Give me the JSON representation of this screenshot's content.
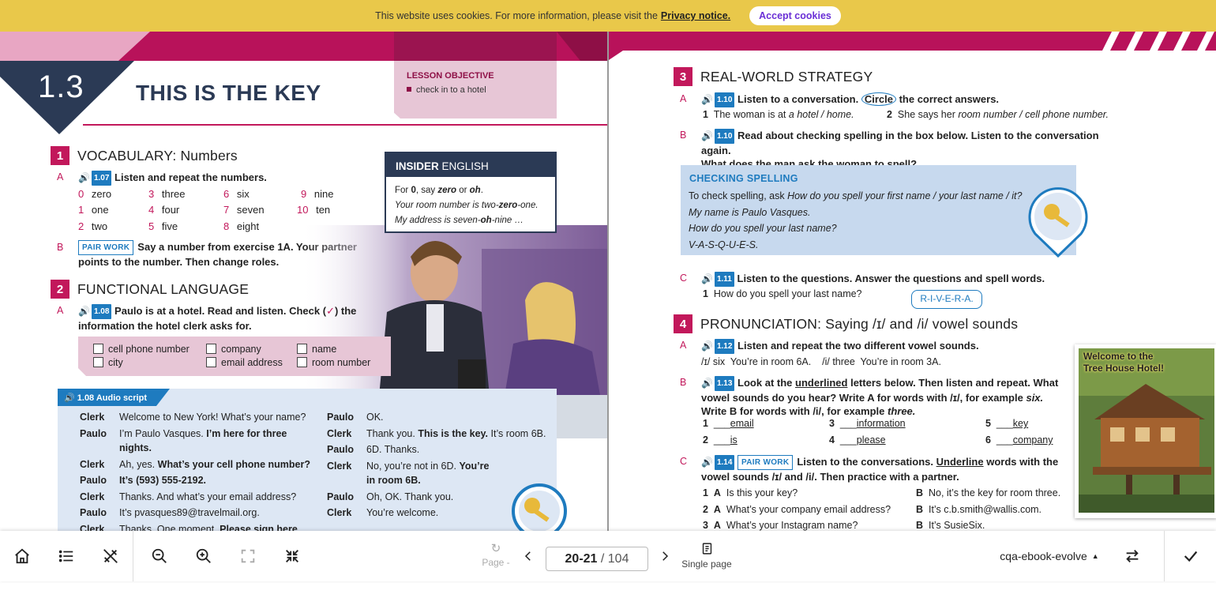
{
  "cookie_bar": {
    "text": "This website uses cookies. For more information, please visit the",
    "link": "Privacy notice.",
    "button": "Accept cookies"
  },
  "left_page": {
    "lesson_number": "1.3",
    "lesson_title": "THIS IS THE KEY",
    "objective_heading": "LESSON OBJECTIVE",
    "objective_item": "check in to a hotel",
    "section1": {
      "number": "1",
      "title": "VOCABULARY: Numbers",
      "a_letter": "A",
      "a_track": "1.07",
      "a_instruction": "Listen and repeat the numbers.",
      "numbers": [
        {
          "n": "0",
          "w": "zero"
        },
        {
          "n": "3",
          "w": "three"
        },
        {
          "n": "6",
          "w": "six"
        },
        {
          "n": "9",
          "w": "nine"
        },
        {
          "n": "1",
          "w": "one"
        },
        {
          "n": "4",
          "w": "four"
        },
        {
          "n": "7",
          "w": "seven"
        },
        {
          "n": "10",
          "w": "ten"
        },
        {
          "n": "2",
          "w": "two"
        },
        {
          "n": "5",
          "w": "five"
        },
        {
          "n": "8",
          "w": "eight"
        }
      ],
      "b_letter": "B",
      "b_tag": "PAIR WORK",
      "b_instruction_1": "Say a number from exercise 1A. Your partner",
      "b_instruction_2": "points to the number. Then change roles."
    },
    "insider": {
      "heading_bold": "INSIDER",
      "heading_rest": "ENGLISH",
      "line1_a": "For",
      "line1_b": "0",
      "line1_c": ", say",
      "line1_d": "zero",
      "line1_e": "or",
      "line1_f": "oh",
      "line2_a": "Your room number is two-",
      "line2_b": "zero",
      "line2_c": "-one.",
      "line3_a": "My address is seven-",
      "line3_b": "oh",
      "line3_c": "-nine …"
    },
    "section2": {
      "number": "2",
      "title": "FUNCTIONAL LANGUAGE",
      "a_letter": "A",
      "a_track": "1.08",
      "a_instruction_1": "Paulo is at a hotel. Read and listen. Check (",
      "a_check": "✓",
      "a_instruction_1b": ") the",
      "a_instruction_2": "information the hotel clerk asks for.",
      "checkboxes": [
        "cell phone number",
        "company",
        "name",
        "city",
        "email address",
        "room number"
      ]
    },
    "script": {
      "title": "1.08 Audio script",
      "left": [
        {
          "speaker": "Clerk",
          "text": "Welcome to New York! What’s your name?",
          "bold": ""
        },
        {
          "speaker": "Paulo",
          "text": "I’m Paulo Vasques.",
          "bold": "I’m here for three"
        },
        {
          "speaker": "",
          "text": "",
          "bold": "nights."
        },
        {
          "speaker": "Clerk",
          "text": "Ah, yes.",
          "bold": "What’s your cell phone number?"
        },
        {
          "speaker": "Paulo",
          "text": "",
          "bold": "It’s (593) 555-2192."
        },
        {
          "speaker": "Clerk",
          "text": "Thanks. And what’s your email address?",
          "bold": ""
        },
        {
          "speaker": "Paulo",
          "text": "It’s pvasques89@travelmail.org.",
          "bold": ""
        },
        {
          "speaker": "Clerk",
          "text": "Thanks. One moment.",
          "bold": "Please sign here."
        }
      ],
      "right": [
        {
          "speaker": "Paulo",
          "text": "OK.",
          "bold": "",
          "after": ""
        },
        {
          "speaker": "Clerk",
          "text": "Thank you.",
          "bold": "This is the key.",
          "after": "It’s room 6B."
        },
        {
          "speaker": "Paulo",
          "text": "6D. Thanks.",
          "bold": "",
          "after": ""
        },
        {
          "speaker": "Clerk",
          "text": "No, you’re not in 6D.",
          "bold": "You’re",
          "after": ""
        },
        {
          "speaker": "",
          "text": "",
          "bold": "in room 6B.",
          "after": ""
        },
        {
          "speaker": "Paulo",
          "text": "Oh, OK. Thank you.",
          "bold": "",
          "after": ""
        },
        {
          "speaker": "Clerk",
          "text": "You’re welcome.",
          "bold": "",
          "after": ""
        }
      ]
    }
  },
  "right_page": {
    "section3": {
      "number": "3",
      "title": "REAL-WORLD STRATEGY",
      "a_letter": "A",
      "a_track": "1.10",
      "a_instruction_1": "Listen to a conversation.",
      "a_circle": "Circle",
      "a_instruction_2": "the correct answers.",
      "a_q1_n": "1",
      "a_q1": "The woman is at",
      "a_q1_i": "a hotel / home.",
      "a_q2_n": "2",
      "a_q2": "She says her",
      "a_q2_i": "room number / cell phone number.",
      "b_letter": "B",
      "b_track": "1.10",
      "b_instruction_1": "Read about checking spelling in the box below. Listen to the conversation again.",
      "b_instruction_2": "What does the man ask the woman to spell?",
      "box_title": "CHECKING SPELLING",
      "box_line1_a": "To check spelling, ask",
      "box_line1_b": "How do you spell your first name / your last name / it?",
      "box_line2": "My name is Paulo Vasques.",
      "box_line3": "How do you spell your last name?",
      "box_line4": "V-A-S-Q-U-E-S.",
      "c_letter": "C",
      "c_track": "1.11",
      "c_instruction": "Listen to the questions. Answer the questions and spell words.",
      "c_q1_n": "1",
      "c_q1": "How do you spell your last name?",
      "c_bubble": "R-I-V-E-R-A."
    },
    "section4": {
      "number": "4",
      "title": "PRONUNCIATION: Saying /ɪ/ and /i/ vowel sounds",
      "a_letter": "A",
      "a_track": "1.12",
      "a_instruction": "Listen and repeat the two different vowel sounds.",
      "a_line": "/ɪ/ six  You’re in room 6A.    /i/ three  You’re in room 3A.",
      "b_letter": "B",
      "b_track": "1.13",
      "b_instruction_1a": "Look at the",
      "b_instruction_1b": "underlined",
      "b_instruction_1c": "letters below. Then listen and repeat. What",
      "b_instruction_2a": "vowel sounds do you hear? Write A for words with /ɪ/, for example",
      "b_instruction_2b": "six.",
      "b_instruction_3a": "Write B for words with /i/, for example",
      "b_instruction_3b": "three.",
      "words": [
        {
          "n": "1",
          "w": "email"
        },
        {
          "n": "3",
          "w": "information"
        },
        {
          "n": "5",
          "w": "key"
        },
        {
          "n": "2",
          "w": "is"
        },
        {
          "n": "4",
          "w": "please"
        },
        {
          "n": "6",
          "w": "company"
        }
      ],
      "c_letter": "C",
      "c_track": "1.14",
      "c_tag": "PAIR WORK",
      "c_instruction_1a": "Listen to the conversations.",
      "c_instruction_1b": "Underline",
      "c_instruction_1c": "words with the",
      "c_instruction_2": "vowel sounds /ɪ/ and /i/. Then practice with a partner.",
      "pairs": [
        {
          "n": "1",
          "q": "Is this your key?",
          "a": "No, it’s the key for room three."
        },
        {
          "n": "2",
          "q": "What’s your company email address?",
          "a": "It’s c.b.smith@wallis.com."
        },
        {
          "n": "3",
          "q": "What’s your Instagram name?",
          "a": "It’s SusieSix."
        }
      ],
      "pair_a": "A",
      "pair_b": "B"
    },
    "photo_caption_1": "Welcome to the",
    "photo_caption_2": "Tree House Hotel!"
  },
  "toolbar": {
    "page_label": "Page -",
    "page_input": "20-21",
    "page_total": "/ 104",
    "single_page": "Single page",
    "book_name": "cqa-ebook-evolve"
  },
  "colors": {
    "magenta": "#c2185b",
    "blue": "#1e7bbf",
    "navy": "#2b3a55",
    "cookie": "#e9c84a"
  }
}
